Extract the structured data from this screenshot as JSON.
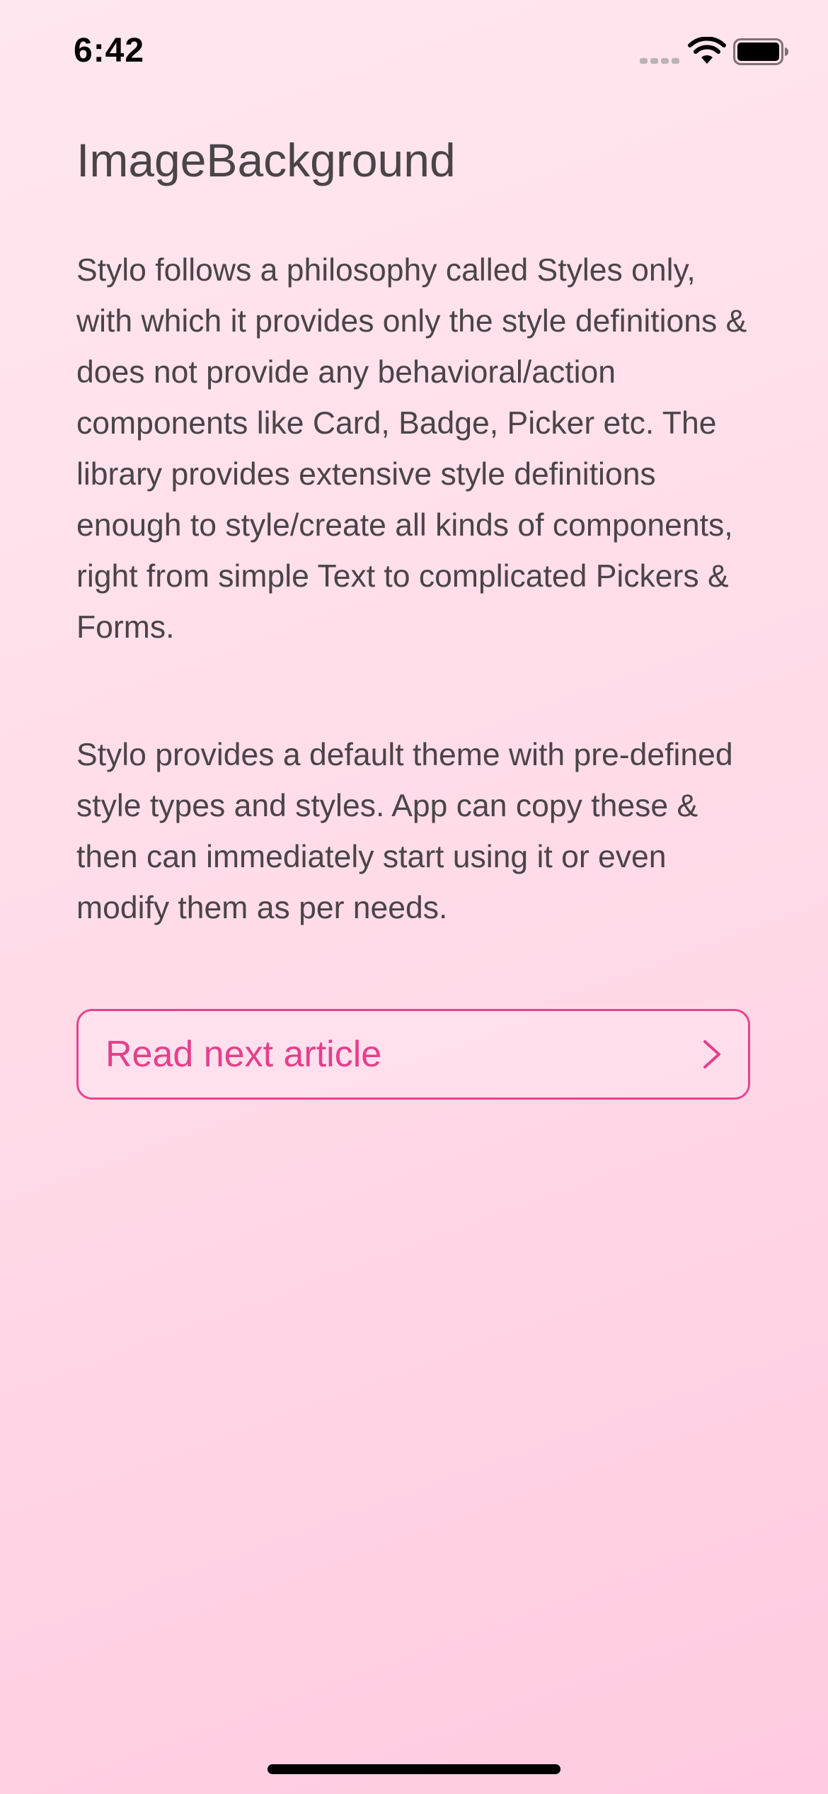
{
  "status_bar": {
    "time": "6:42"
  },
  "article": {
    "title": "ImageBackground",
    "paragraphs": [
      "Stylo follows a philosophy called Styles only, with which it provides only the style definitions & does not provide any behavioral/action components like Card, Badge, Picker etc. The library provides extensive style definitions enough to style/create all kinds of components, right from simple Text to complicated Pickers & Forms.",
      "Stylo provides a default theme with pre-defined style types and styles. App can copy these & then can immediately start using it or even modify them as per needs."
    ],
    "next_button_label": "Read next article"
  },
  "icons": {
    "signal": "cellular-signal-icon",
    "wifi": "wifi-icon",
    "battery": "battery-icon",
    "chevron": "chevron-right-icon"
  },
  "colors": {
    "accent": "#e3408b",
    "text": "#4a4447",
    "background_top": "#ffe7ef",
    "background_bottom": "#ffcadf"
  }
}
